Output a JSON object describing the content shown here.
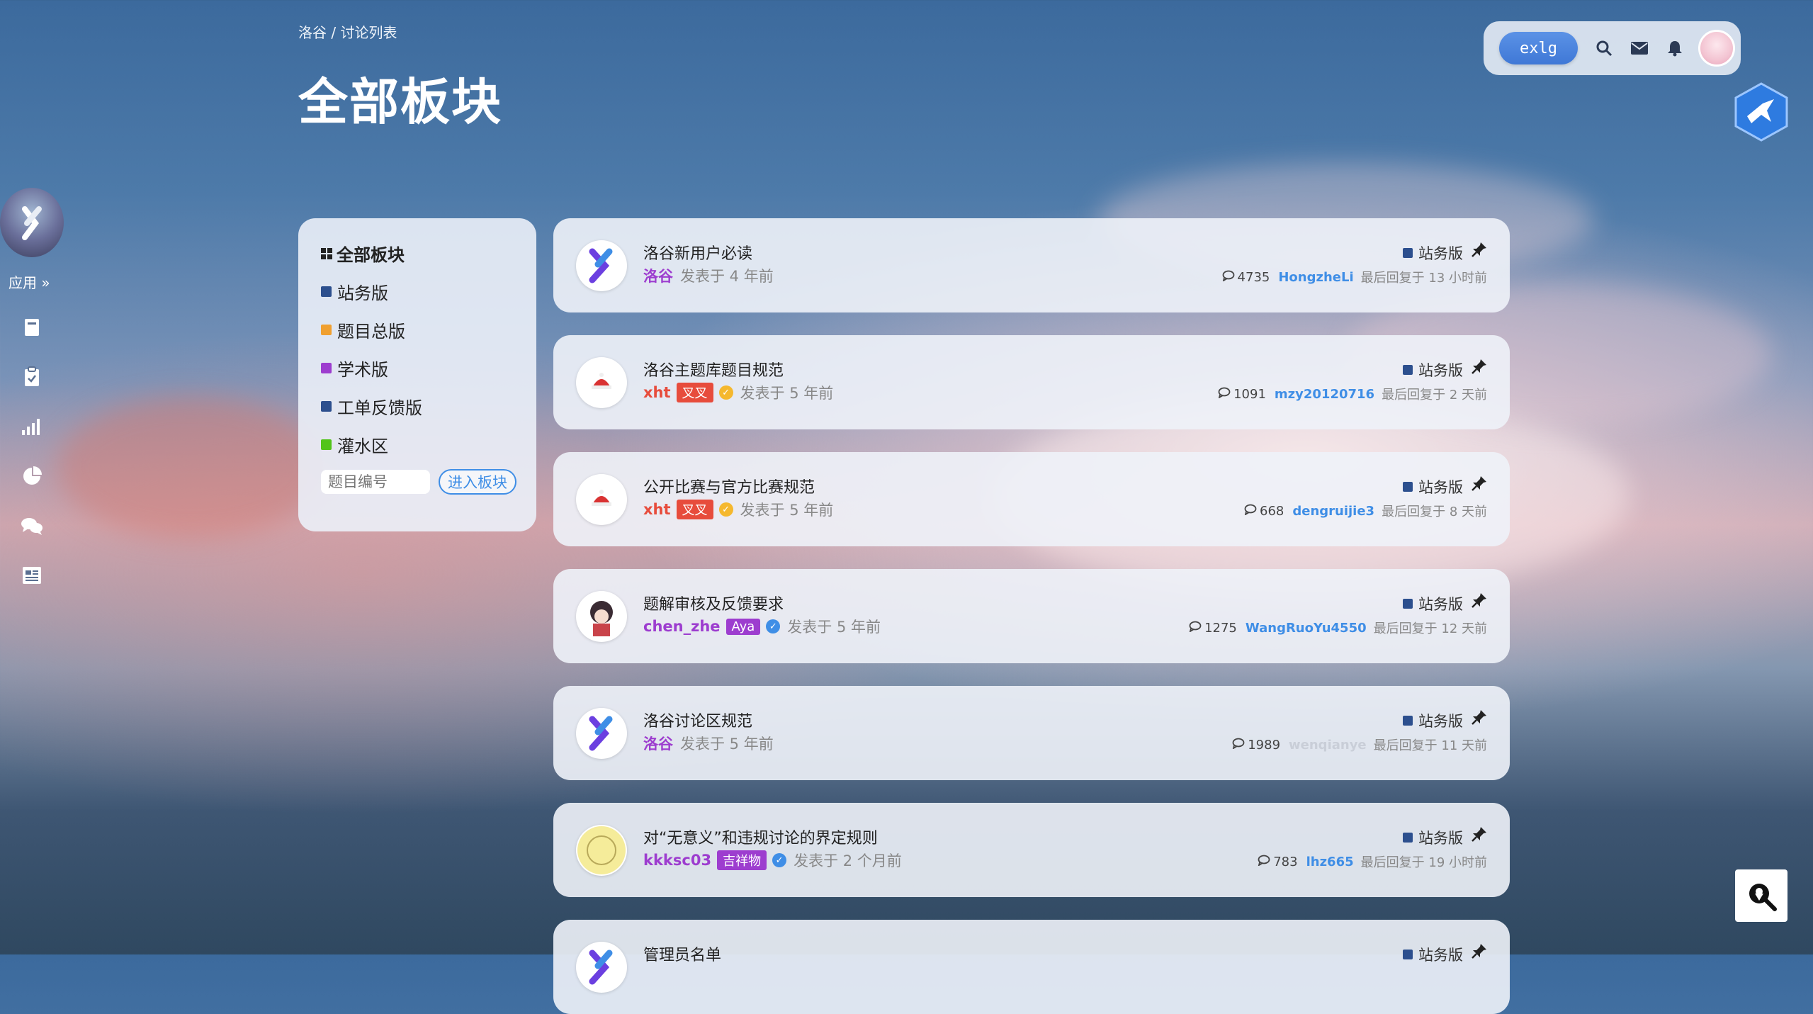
{
  "header": {
    "breadcrumb": "洛谷 / 讨论列表",
    "title": "全部板块"
  },
  "topbar": {
    "exlg_label": "exlg"
  },
  "sidebar": {
    "apps_label": "应用 »"
  },
  "forums": {
    "title": "全部板块",
    "items": [
      {
        "label": "站务版",
        "color": "#2c4f8e"
      },
      {
        "label": "题目总版",
        "color": "#f0a030"
      },
      {
        "label": "学术版",
        "color": "#9d3dcf"
      },
      {
        "label": "工单反馈版",
        "color": "#2c4f8e"
      },
      {
        "label": "灌水区",
        "color": "#52c41a"
      }
    ],
    "input_placeholder": "题目编号",
    "enter_button": "进入板块"
  },
  "posts": [
    {
      "title": "洛谷新用户必读",
      "author": "洛谷",
      "author_color": "#9d3dcf",
      "tag": "",
      "tag_color": "",
      "verified": "",
      "posted": "发表于 4 年前",
      "board": "站务版",
      "replies": "4735",
      "last_user": "HongzheLi",
      "last_time": "最后回复于 13 小时前",
      "avatar": "luogu"
    },
    {
      "title": "洛谷主题库题目规范",
      "author": "xht",
      "author_color": "#e74c3c",
      "tag": "叉叉",
      "tag_color": "#e74c3c",
      "verified": "gold",
      "posted": "发表于 5 年前",
      "board": "站务版",
      "replies": "1091",
      "last_user": "mzy20120716",
      "last_time": "最后回复于 2 天前",
      "avatar": "xht"
    },
    {
      "title": "公开比赛与官方比赛规范",
      "author": "xht",
      "author_color": "#e74c3c",
      "tag": "叉叉",
      "tag_color": "#e74c3c",
      "verified": "gold",
      "posted": "发表于 5 年前",
      "board": "站务版",
      "replies": "668",
      "last_user": "dengruijie3",
      "last_time": "最后回复于 8 天前",
      "avatar": "xht"
    },
    {
      "title": "题解审核及反馈要求",
      "author": "chen_zhe",
      "author_color": "#9d3dcf",
      "tag": "Aya",
      "tag_color": "#9d3dcf",
      "verified": "blue",
      "posted": "发表于 5 年前",
      "board": "站务版",
      "replies": "1275",
      "last_user": "WangRuoYu4550",
      "last_time": "最后回复于 12 天前",
      "avatar": "chen"
    },
    {
      "title": "洛谷讨论区规范",
      "author": "洛谷",
      "author_color": "#9d3dcf",
      "tag": "",
      "tag_color": "",
      "verified": "",
      "posted": "发表于 5 年前",
      "board": "站务版",
      "replies": "1989",
      "last_user": "wenqianye",
      "last_time": "最后回复于 11 天前",
      "avatar": "luogu"
    },
    {
      "title": "对“无意义”和违规讨论的界定规则",
      "author": "kkksc03",
      "author_color": "#9d3dcf",
      "tag": "吉祥物",
      "tag_color": "#9d3dcf",
      "verified": "blue",
      "posted": "发表于 2 个月前",
      "board": "站务版",
      "replies": "783",
      "last_user": "lhz665",
      "last_time": "最后回复于 19 小时前",
      "avatar": "kkk"
    },
    {
      "title": "管理员名单",
      "author": "",
      "author_color": "",
      "tag": "",
      "tag_color": "",
      "verified": "",
      "posted": "",
      "board": "站务版",
      "replies": "",
      "last_user": "",
      "last_time": "",
      "avatar": "luogu"
    }
  ]
}
